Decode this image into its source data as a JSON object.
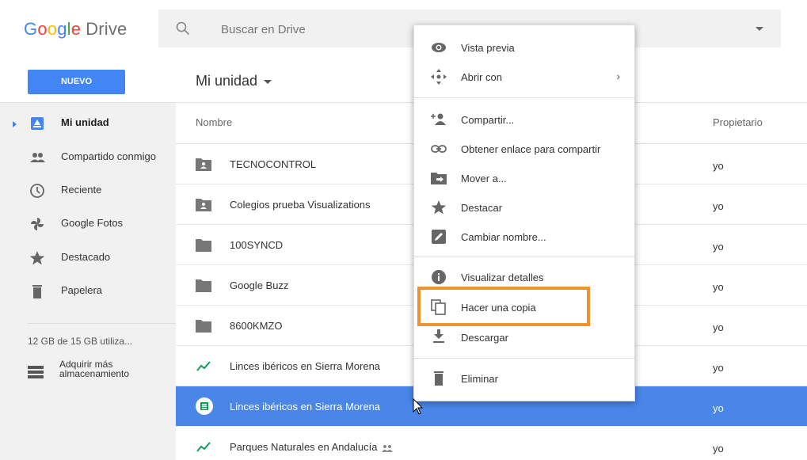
{
  "header": {
    "logo_google": [
      "G",
      "o",
      "o",
      "g",
      "l",
      "e"
    ],
    "logo_drive": "Drive",
    "search_placeholder": "Buscar en Drive"
  },
  "toolbar": {
    "new_button": "NUEVO",
    "location_title": "Mi unidad"
  },
  "sidebar": {
    "items": [
      {
        "label": "Mi unidad",
        "icon": "drive-icon",
        "active": true
      },
      {
        "label": "Compartido conmigo",
        "icon": "people-icon"
      },
      {
        "label": "Reciente",
        "icon": "clock-icon"
      },
      {
        "label": "Google Fotos",
        "icon": "pinwheel-icon"
      },
      {
        "label": "Destacado",
        "icon": "star-icon"
      },
      {
        "label": "Papelera",
        "icon": "trash-icon"
      }
    ],
    "storage": "12 GB de 15 GB utiliza...",
    "buy_storage": "Adquirir más almacenamiento"
  },
  "list": {
    "col_name": "Nombre",
    "col_owner": "Propietario",
    "rows": [
      {
        "name": "TECNOCONTROL",
        "owner": "yo",
        "type": "shared-folder"
      },
      {
        "name": "Colegios prueba Visualizations",
        "owner": "yo",
        "type": "shared-folder"
      },
      {
        "name": "100SYNCD",
        "owner": "yo",
        "type": "folder"
      },
      {
        "name": "Google Buzz",
        "owner": "yo",
        "type": "folder"
      },
      {
        "name": "8600KMZO",
        "owner": "yo",
        "type": "folder"
      },
      {
        "name": "Linces ibéricos en Sierra Morena",
        "owner": "yo",
        "type": "chart"
      },
      {
        "name": "Linces ibéricos en Sierra Morena",
        "owner": "yo",
        "type": "sheet",
        "selected": true
      },
      {
        "name": "Parques Naturales en Andalucía",
        "owner": "yo",
        "type": "chart",
        "shared": true
      }
    ]
  },
  "context_menu": {
    "items": [
      {
        "label": "Vista previa",
        "icon": "eye-icon"
      },
      {
        "label": "Abrir con",
        "icon": "move-arrows-icon",
        "submenu": "›"
      },
      {
        "label": "Compartir...",
        "icon": "add-person-icon"
      },
      {
        "label": "Obtener enlace para compartir",
        "icon": "link-icon"
      },
      {
        "label": "Mover a...",
        "icon": "move-folder-icon"
      },
      {
        "label": "Destacar",
        "icon": "star-icon"
      },
      {
        "label": "Cambiar nombre...",
        "icon": "pencil-icon"
      },
      {
        "label": "Visualizar detalles",
        "icon": "info-icon"
      },
      {
        "label": "Hacer una copia",
        "icon": "copy-icon",
        "highlighted": true
      },
      {
        "label": "Descargar",
        "icon": "download-icon"
      },
      {
        "label": "Eliminar",
        "icon": "trash-icon"
      }
    ]
  },
  "colors": {
    "accent": "#4285f4",
    "selected_row": "#4a86e8",
    "highlight_box": "#f0922b",
    "sidebar_bg": "#f1f1f1"
  }
}
